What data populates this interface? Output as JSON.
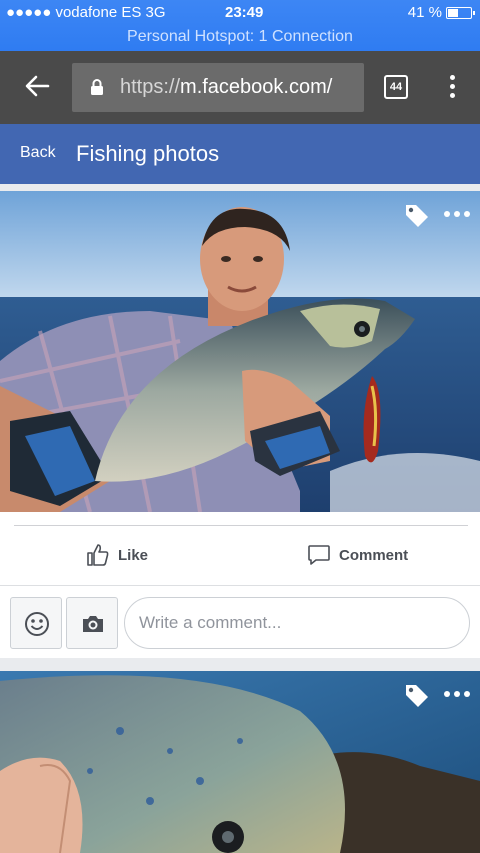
{
  "status_bar": {
    "carrier": "●●●●● vodafone ES   3G",
    "time": "23:49",
    "battery_percent": "41 %",
    "battery_level": 0.41,
    "hotspot": "Personal Hotspot: 1 Connection"
  },
  "browser": {
    "url_scheme": "https://",
    "url_host": "m.facebook.com/",
    "tab_count": "44",
    "icons": [
      "back-arrow-icon",
      "lock-icon",
      "tabs-icon",
      "menu-dots-icon"
    ]
  },
  "header": {
    "back_label": "Back",
    "title": "Fishing photos",
    "color": "#4267b2"
  },
  "post": {
    "like_label": "Like",
    "comment_label": "Comment",
    "comment_placeholder": "Write a comment...",
    "icons": [
      "tag-icon",
      "more-icon",
      "like-icon",
      "comment-icon",
      "emoji-icon",
      "camera-icon"
    ]
  }
}
